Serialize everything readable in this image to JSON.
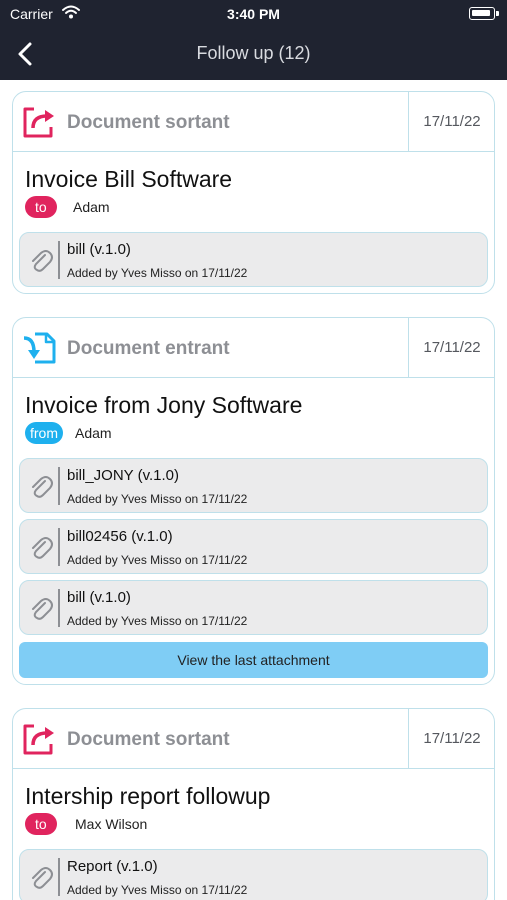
{
  "status_bar": {
    "carrier": "Carrier",
    "time": "3:40 PM"
  },
  "nav": {
    "title": "Follow up (12)"
  },
  "cards": [
    {
      "type": "Document sortant",
      "icon": "outgoing-document-icon",
      "date": "17/11/22",
      "title": "Invoice Bill Software",
      "direction": "to",
      "person": "Adam",
      "attachments": [
        {
          "name": "bill (v.1.0)",
          "meta": "Added by Yves Misso on 17/11/22"
        }
      ]
    },
    {
      "type": "Document entrant",
      "icon": "incoming-document-icon",
      "date": "17/11/22",
      "title": "Invoice from Jony Software",
      "direction": "from",
      "person": "Adam",
      "attachments": [
        {
          "name": "bill_JONY (v.1.0)",
          "meta": "Added by Yves Misso on 17/11/22"
        },
        {
          "name": "bill02456 (v.1.0)",
          "meta": "Added by Yves Misso on 17/11/22"
        },
        {
          "name": "bill (v.1.0)",
          "meta": "Added by Yves Misso on 17/11/22"
        }
      ],
      "view_button": "View the last attachment"
    },
    {
      "type": "Document sortant",
      "icon": "outgoing-document-icon",
      "date": "17/11/22",
      "title": "Intership report followup",
      "direction": "to",
      "person": "Max Wilson",
      "attachments": [
        {
          "name": "Report (v.1.0)",
          "meta": "Added by Yves Misso on 17/11/22"
        }
      ]
    }
  ],
  "colors": {
    "nav_bg": "#1f2330",
    "to_badge": "#e0245e",
    "from_badge": "#1eb0ee",
    "card_border": "#bfe0ea",
    "view_button_bg": "#7fcdf5",
    "outgoing_icon": "#e0245e",
    "incoming_icon": "#1eb0ee"
  }
}
